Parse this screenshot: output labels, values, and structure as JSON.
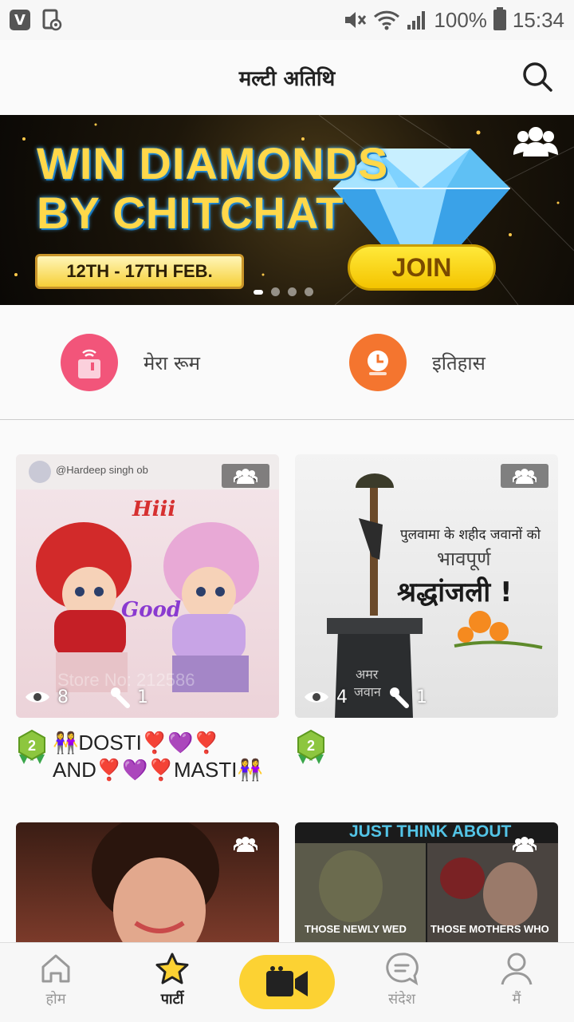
{
  "status": {
    "battery": "100%",
    "time": "15:34"
  },
  "header": {
    "title": "मल्टी अतिथि"
  },
  "banner": {
    "headline_line1": "WIN DIAMONDS",
    "headline_line2": "BY CHITCHAT",
    "dates": "12TH - 17TH FEB.",
    "join_label": "JOIN",
    "page_count": 4,
    "active_page": 1
  },
  "quick_links": [
    {
      "label": "मेरा रूम",
      "icon": "room-icon",
      "color": "#f2557a"
    },
    {
      "label": "इतिहास",
      "icon": "history-icon",
      "color": "#f4752f"
    }
  ],
  "rooms": [
    {
      "title_line1": "👭DOSTI❣️💜❣️",
      "title_line2": "AND❣️💜❣️MASTI👭",
      "viewers": "8",
      "hosts": "1",
      "level": "2",
      "host_tag": "@Hardeep singh ob",
      "image_text_1": "Hiii",
      "image_text_2": "Good",
      "image_text_3": "Store No: 212586"
    },
    {
      "title_line1": "",
      "title_line2": "",
      "viewers": "4",
      "hosts": "1",
      "level": "2",
      "image_text_1": "पुलवामा के शहीद जवानों को",
      "image_text_2": "भावपूर्ण",
      "image_text_3": "श्रद्धांजली !",
      "image_text_4": "अमर",
      "image_text_5": "जवान"
    },
    {
      "image_text_1": ""
    },
    {
      "image_text_1": "JUST THINK ABOUT",
      "image_text_2": "THOSE NEWLY WED",
      "image_text_3": "THOSE MOTHERS WHO"
    }
  ],
  "nav": {
    "home": "होम",
    "party": "पार्टी",
    "messages": "संदेश",
    "me": "मैं",
    "active": "party"
  },
  "colors": {
    "accent": "#fcd233",
    "room_icon": "#f2557a",
    "history_icon": "#f4752f"
  }
}
